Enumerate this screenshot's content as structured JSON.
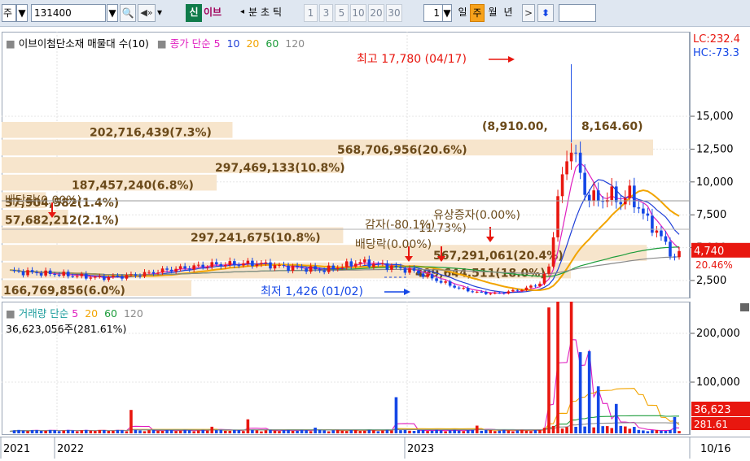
{
  "toolbar": {
    "market": "주",
    "code": "131400",
    "badge": "신",
    "name": "이브",
    "nav_left": "◂",
    "minute": "분",
    "second": "초",
    "tick": "틱",
    "periods": [
      "1",
      "3",
      "5",
      "10",
      "20",
      "30"
    ],
    "period_count": "1",
    "day": "일",
    "week": "주",
    "month": "월",
    "year": "년",
    "nav_right": ">"
  },
  "legend": {
    "name": "이브이첨단소재 매물대 수(10)",
    "price": "종가 단순",
    "ma": [
      "5",
      "10",
      "20",
      "60",
      "120"
    ],
    "volume": "거래량 단순",
    "vma": [
      "5",
      "20",
      "60",
      "120"
    ],
    "volume_value": "36,623,056주(281.61%)"
  },
  "colors": {
    "up": "#e8170f",
    "down": "#1447e6",
    "ma5": "#e020c0",
    "ma10": "#1f3fd8",
    "ma20": "#f2a400",
    "ma60": "#1c9c3a",
    "ma120": "#8a8a8a",
    "profile": "#f7e5cc"
  },
  "chart_data": [
    {
      "type": "candlestick",
      "title": "이브이첨단소재 매물대 수(10)",
      "y_ticks": [
        2500,
        5000,
        7500,
        10000,
        12500,
        15000
      ],
      "y_tick_labels": [
        "2,500",
        "5,000",
        "7,500",
        "10,000",
        "12,500",
        "15,000"
      ],
      "x_labels": [
        "2021",
        "2022",
        "2023",
        "10/16"
      ],
      "y_label_extra": [
        "LC:232.4",
        "HC:-73.3"
      ],
      "last_price": 4740,
      "last_price_label": "4,740",
      "last_change_label": "20.46%",
      "high_label": "최고 17,780 (04/17)",
      "low_label": "최저 1,426 (01/02)",
      "volume_profile": [
        {
          "label": "166,769,856(6.0%)",
          "pct": 6.0
        },
        {
          "label": "499,644,511(18.0%)",
          "pct": 18.0
        },
        {
          "label": "567,291,061(20.4%)",
          "pct": 20.4
        },
        {
          "label": "297,241,675(10.8%)",
          "pct": 10.8
        },
        {
          "label": "57,682,212(2.1%)",
          "pct": 2.1
        },
        {
          "label": "37,904,582(1.4%)",
          "pct": 1.4
        },
        {
          "label": "187,457,240(6.8%)",
          "pct": 6.8
        },
        {
          "label": "297,469,133(10.8%)",
          "pct": 10.8
        },
        {
          "label": "568,706,956(20.6%)",
          "pct": 20.6
        },
        {
          "label": "202,716,439(7.3%)",
          "pct": 7.3
        }
      ],
      "events": [
        "배당락(0.00%)",
        "감자(-80.1%)",
        "배당락(0.00%)",
        "유상증자(0.00%)",
        "(8,910.00, ",
        "8,164.60)",
        "11.73%)"
      ]
    },
    {
      "type": "bar",
      "title": "거래량",
      "y_ticks": [
        100000,
        200000
      ],
      "y_tick_labels": [
        "100,000",
        "200,000"
      ],
      "last_volume_label": "36,623",
      "last_ratio_label": "281.61"
    }
  ]
}
